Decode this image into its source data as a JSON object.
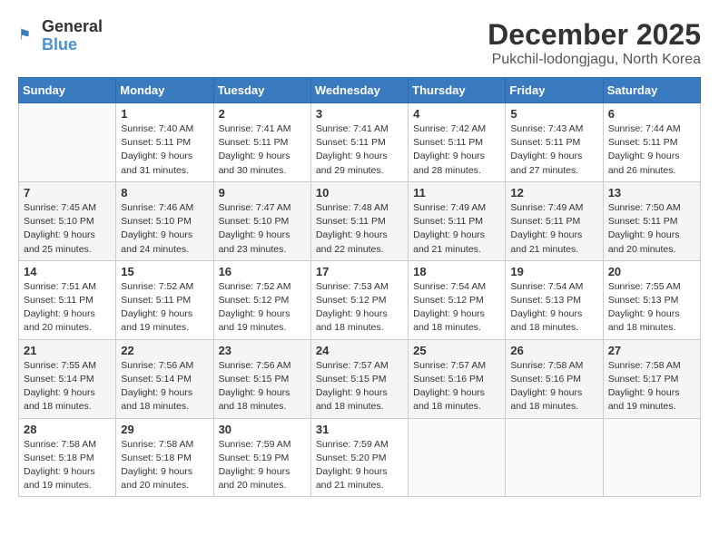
{
  "header": {
    "logo": {
      "general": "General",
      "blue": "Blue"
    },
    "title": "December 2025",
    "subtitle": "Pukchil-lodongjagu, North Korea"
  },
  "days_of_week": [
    "Sunday",
    "Monday",
    "Tuesday",
    "Wednesday",
    "Thursday",
    "Friday",
    "Saturday"
  ],
  "weeks": [
    [
      {
        "day": "",
        "sunrise": "",
        "sunset": "",
        "daylight": ""
      },
      {
        "day": "1",
        "sunrise": "Sunrise: 7:40 AM",
        "sunset": "Sunset: 5:11 PM",
        "daylight": "Daylight: 9 hours and 31 minutes."
      },
      {
        "day": "2",
        "sunrise": "Sunrise: 7:41 AM",
        "sunset": "Sunset: 5:11 PM",
        "daylight": "Daylight: 9 hours and 30 minutes."
      },
      {
        "day": "3",
        "sunrise": "Sunrise: 7:41 AM",
        "sunset": "Sunset: 5:11 PM",
        "daylight": "Daylight: 9 hours and 29 minutes."
      },
      {
        "day": "4",
        "sunrise": "Sunrise: 7:42 AM",
        "sunset": "Sunset: 5:11 PM",
        "daylight": "Daylight: 9 hours and 28 minutes."
      },
      {
        "day": "5",
        "sunrise": "Sunrise: 7:43 AM",
        "sunset": "Sunset: 5:11 PM",
        "daylight": "Daylight: 9 hours and 27 minutes."
      },
      {
        "day": "6",
        "sunrise": "Sunrise: 7:44 AM",
        "sunset": "Sunset: 5:11 PM",
        "daylight": "Daylight: 9 hours and 26 minutes."
      }
    ],
    [
      {
        "day": "7",
        "sunrise": "Sunrise: 7:45 AM",
        "sunset": "Sunset: 5:10 PM",
        "daylight": "Daylight: 9 hours and 25 minutes."
      },
      {
        "day": "8",
        "sunrise": "Sunrise: 7:46 AM",
        "sunset": "Sunset: 5:10 PM",
        "daylight": "Daylight: 9 hours and 24 minutes."
      },
      {
        "day": "9",
        "sunrise": "Sunrise: 7:47 AM",
        "sunset": "Sunset: 5:10 PM",
        "daylight": "Daylight: 9 hours and 23 minutes."
      },
      {
        "day": "10",
        "sunrise": "Sunrise: 7:48 AM",
        "sunset": "Sunset: 5:11 PM",
        "daylight": "Daylight: 9 hours and 22 minutes."
      },
      {
        "day": "11",
        "sunrise": "Sunrise: 7:49 AM",
        "sunset": "Sunset: 5:11 PM",
        "daylight": "Daylight: 9 hours and 21 minutes."
      },
      {
        "day": "12",
        "sunrise": "Sunrise: 7:49 AM",
        "sunset": "Sunset: 5:11 PM",
        "daylight": "Daylight: 9 hours and 21 minutes."
      },
      {
        "day": "13",
        "sunrise": "Sunrise: 7:50 AM",
        "sunset": "Sunset: 5:11 PM",
        "daylight": "Daylight: 9 hours and 20 minutes."
      }
    ],
    [
      {
        "day": "14",
        "sunrise": "Sunrise: 7:51 AM",
        "sunset": "Sunset: 5:11 PM",
        "daylight": "Daylight: 9 hours and 20 minutes."
      },
      {
        "day": "15",
        "sunrise": "Sunrise: 7:52 AM",
        "sunset": "Sunset: 5:11 PM",
        "daylight": "Daylight: 9 hours and 19 minutes."
      },
      {
        "day": "16",
        "sunrise": "Sunrise: 7:52 AM",
        "sunset": "Sunset: 5:12 PM",
        "daylight": "Daylight: 9 hours and 19 minutes."
      },
      {
        "day": "17",
        "sunrise": "Sunrise: 7:53 AM",
        "sunset": "Sunset: 5:12 PM",
        "daylight": "Daylight: 9 hours and 18 minutes."
      },
      {
        "day": "18",
        "sunrise": "Sunrise: 7:54 AM",
        "sunset": "Sunset: 5:12 PM",
        "daylight": "Daylight: 9 hours and 18 minutes."
      },
      {
        "day": "19",
        "sunrise": "Sunrise: 7:54 AM",
        "sunset": "Sunset: 5:13 PM",
        "daylight": "Daylight: 9 hours and 18 minutes."
      },
      {
        "day": "20",
        "sunrise": "Sunrise: 7:55 AM",
        "sunset": "Sunset: 5:13 PM",
        "daylight": "Daylight: 9 hours and 18 minutes."
      }
    ],
    [
      {
        "day": "21",
        "sunrise": "Sunrise: 7:55 AM",
        "sunset": "Sunset: 5:14 PM",
        "daylight": "Daylight: 9 hours and 18 minutes."
      },
      {
        "day": "22",
        "sunrise": "Sunrise: 7:56 AM",
        "sunset": "Sunset: 5:14 PM",
        "daylight": "Daylight: 9 hours and 18 minutes."
      },
      {
        "day": "23",
        "sunrise": "Sunrise: 7:56 AM",
        "sunset": "Sunset: 5:15 PM",
        "daylight": "Daylight: 9 hours and 18 minutes."
      },
      {
        "day": "24",
        "sunrise": "Sunrise: 7:57 AM",
        "sunset": "Sunset: 5:15 PM",
        "daylight": "Daylight: 9 hours and 18 minutes."
      },
      {
        "day": "25",
        "sunrise": "Sunrise: 7:57 AM",
        "sunset": "Sunset: 5:16 PM",
        "daylight": "Daylight: 9 hours and 18 minutes."
      },
      {
        "day": "26",
        "sunrise": "Sunrise: 7:58 AM",
        "sunset": "Sunset: 5:16 PM",
        "daylight": "Daylight: 9 hours and 18 minutes."
      },
      {
        "day": "27",
        "sunrise": "Sunrise: 7:58 AM",
        "sunset": "Sunset: 5:17 PM",
        "daylight": "Daylight: 9 hours and 19 minutes."
      }
    ],
    [
      {
        "day": "28",
        "sunrise": "Sunrise: 7:58 AM",
        "sunset": "Sunset: 5:18 PM",
        "daylight": "Daylight: 9 hours and 19 minutes."
      },
      {
        "day": "29",
        "sunrise": "Sunrise: 7:58 AM",
        "sunset": "Sunset: 5:18 PM",
        "daylight": "Daylight: 9 hours and 20 minutes."
      },
      {
        "day": "30",
        "sunrise": "Sunrise: 7:59 AM",
        "sunset": "Sunset: 5:19 PM",
        "daylight": "Daylight: 9 hours and 20 minutes."
      },
      {
        "day": "31",
        "sunrise": "Sunrise: 7:59 AM",
        "sunset": "Sunset: 5:20 PM",
        "daylight": "Daylight: 9 hours and 21 minutes."
      },
      {
        "day": "",
        "sunrise": "",
        "sunset": "",
        "daylight": ""
      },
      {
        "day": "",
        "sunrise": "",
        "sunset": "",
        "daylight": ""
      },
      {
        "day": "",
        "sunrise": "",
        "sunset": "",
        "daylight": ""
      }
    ]
  ]
}
